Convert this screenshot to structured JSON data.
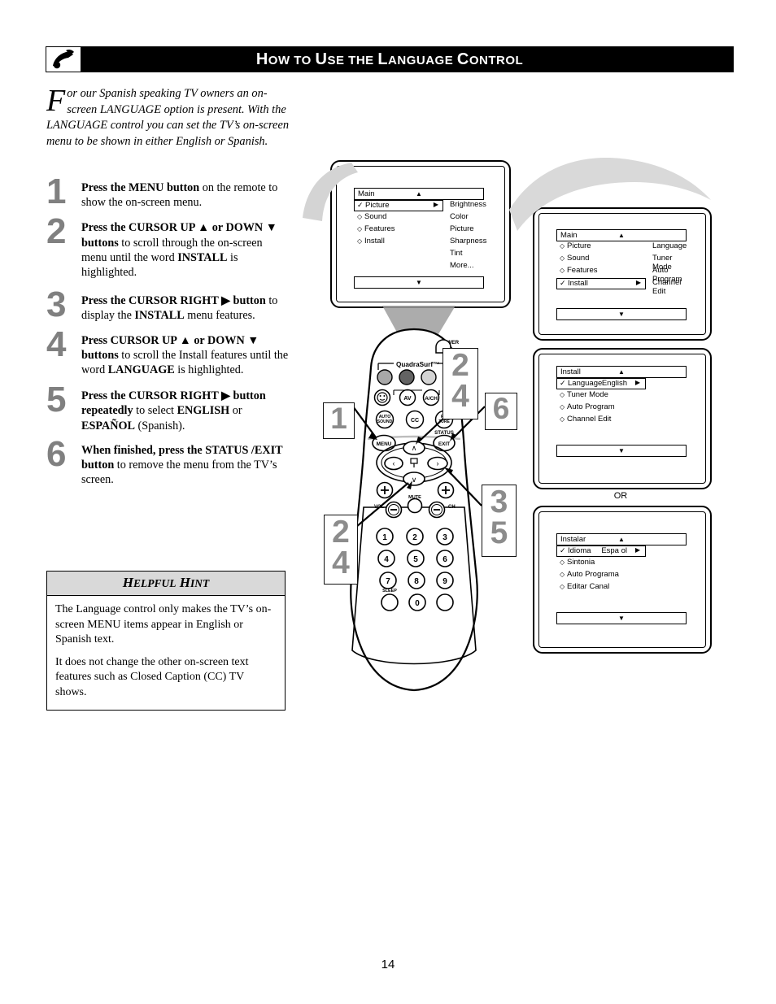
{
  "header": {
    "title_parts": [
      {
        "t": "H",
        "big": true
      },
      {
        "t": "OW",
        "big": false
      },
      {
        "t": " ",
        "big": false
      },
      {
        "t": "TO",
        "big": false
      },
      {
        "t": " ",
        "big": false
      },
      {
        "t": "U",
        "big": true
      },
      {
        "t": "SE",
        "big": false
      },
      {
        "t": " ",
        "big": false
      },
      {
        "t": "THE",
        "big": false
      },
      {
        "t": " ",
        "big": false
      },
      {
        "t": "L",
        "big": true
      },
      {
        "t": "ANGUAGE",
        "big": false
      },
      {
        "t": " ",
        "big": false
      },
      {
        "t": "C",
        "big": true
      },
      {
        "t": "ONTROL",
        "big": false
      }
    ],
    "title_plain": "How to Use the Language Control",
    "logo_icon": "philips-swoosh-logo-icon",
    "bar_color": "#000000"
  },
  "intro": {
    "dropcap": "F",
    "text": "or our Spanish speaking TV owners an on-screen LANGUAGE option is present. With the LANGUAGE control you can set the TV’s on-screen menu to be shown in either English or Spanish."
  },
  "steps": [
    {
      "num": "1",
      "html": "<b>Press the MENU button</b> on the remote to show the on-screen menu."
    },
    {
      "num": "2",
      "html": "<b>Press the CURSOR UP ▲ or DOWN ▼ buttons</b> to scroll through the on-screen menu until the word <b>INSTALL</b> is highlighted."
    },
    {
      "num": "3",
      "html": "<b>Press the CURSOR RIGHT ▶ button</b> to display the <b>INSTALL</b> menu features."
    },
    {
      "num": "4",
      "html": "<b>Press CURSOR UP ▲ or DOWN ▼ buttons</b> to scroll the Install features until the word <b>LANGUAGE</b> is highlighted."
    },
    {
      "num": "5",
      "html": "<b>Press the CURSOR RIGHT ▶ button repeatedly</b> to select <b>ENGLISH</b> or <b>ESPAÑOL</b> (Spanish)."
    },
    {
      "num": "6",
      "html": "<b>When finished, press the STATUS /EXIT button</b> to remove the menu from the TV’s screen."
    }
  ],
  "hint": {
    "title_first": "H",
    "title_rest1": "ELPFUL",
    "title_second": "H",
    "title_rest2": "INT",
    "title_plain": "Helpful Hint",
    "paragraphs": [
      "The Language control only makes the TV’s on-screen MENU items appear in English or Spanish text.",
      "It does not change the other on-screen text features such as Closed Caption (CC) TV shows."
    ],
    "header_bg": "#d9d9d9"
  },
  "osd": {
    "tv_menu": {
      "title": "Main",
      "up_caret": "▲",
      "down_caret": "▼",
      "left_items": [
        {
          "label": "Picture",
          "selected": true,
          "marker": "✓",
          "arrow": "▶"
        },
        {
          "label": "Sound",
          "selected": false,
          "marker": "◇"
        },
        {
          "label": "Features",
          "selected": false,
          "marker": "◇"
        },
        {
          "label": "Install",
          "selected": false,
          "marker": "◇"
        }
      ],
      "right_items": [
        "Brightness",
        "Color",
        "Picture",
        "Sharpness",
        "Tint",
        "More..."
      ]
    },
    "box1": {
      "title": "Main",
      "up_caret": "▲",
      "down_caret": "▼",
      "left_items": [
        {
          "label": "Picture",
          "selected": false,
          "marker": "◇"
        },
        {
          "label": "Sound",
          "selected": false,
          "marker": "◇"
        },
        {
          "label": "Features",
          "selected": false,
          "marker": "◇"
        },
        {
          "label": "Install",
          "selected": true,
          "marker": "✓",
          "arrow": "▶"
        }
      ],
      "right_items": [
        "Language",
        "Tuner Mode",
        "Auto Program",
        "Channel Edit"
      ]
    },
    "box2": {
      "title": "Install",
      "up_caret": "▲",
      "down_caret": "▼",
      "left_items": [
        {
          "label": "Language",
          "selected": true,
          "marker": "✓",
          "value": "English",
          "arrow": "▶"
        },
        {
          "label": "Tuner Mode",
          "selected": false,
          "marker": "◇"
        },
        {
          "label": "Auto Program",
          "selected": false,
          "marker": "◇"
        },
        {
          "label": "Channel Edit",
          "selected": false,
          "marker": "◇"
        }
      ]
    },
    "or_label": "OR",
    "box3": {
      "title": "Instalar",
      "up_caret": "▲",
      "down_caret": "▼",
      "left_items": [
        {
          "label": "Idioma",
          "selected": true,
          "marker": "✓",
          "value": "Espa ol",
          "arrow": "▶"
        },
        {
          "label": "Sintonia",
          "selected": false,
          "marker": "◇"
        },
        {
          "label": "Auto Programa",
          "selected": false,
          "marker": "◇"
        },
        {
          "label": "Editar Canal",
          "selected": false,
          "marker": "◇"
        }
      ]
    }
  },
  "remote": {
    "brand": "QuadraSurf™",
    "labels": {
      "power": "POWER",
      "av": "AV",
      "ach": "A/CH",
      "auto_sound": "AUTO SOUND",
      "cc": "CC",
      "picture": "PICTURE",
      "status": "STATUS",
      "exit": "EXIT",
      "menu": "MENU",
      "mute": "MUTE",
      "ch": "CH",
      "vol": "VOL",
      "sleep": "SLEEP"
    },
    "keypad": [
      "1",
      "2",
      "3",
      "4",
      "5",
      "6",
      "7",
      "8",
      "9",
      "0"
    ],
    "cursor_up": "∧",
    "cursor_down": "∨",
    "cursor_left": "‹",
    "cursor_right": "›"
  },
  "callouts": [
    {
      "id": "co1",
      "lines": [
        "1"
      ]
    },
    {
      "id": "co24a",
      "lines": [
        "2",
        "4"
      ]
    },
    {
      "id": "co6",
      "lines": [
        "6"
      ]
    },
    {
      "id": "co35",
      "lines": [
        "3",
        "5"
      ]
    },
    {
      "id": "co24b",
      "lines": [
        "2",
        "4"
      ]
    }
  ],
  "callout_color": "#8c8c8c",
  "page_number": "14"
}
